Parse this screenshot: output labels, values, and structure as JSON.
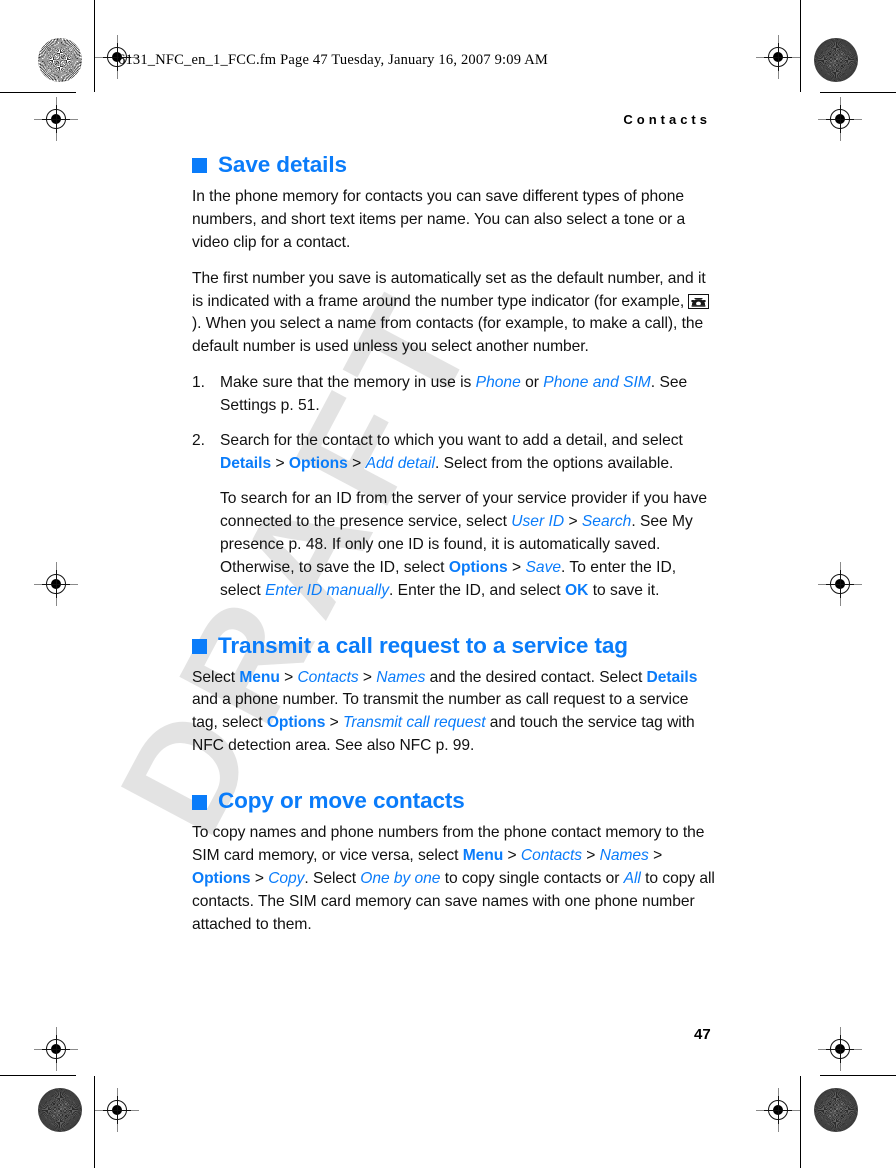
{
  "document": {
    "file_line": "6131_NFC_en_1_FCC.fm  Page 47  Tuesday, January 16, 2007  9:09 AM",
    "running_head": "Contacts",
    "folio": "47",
    "watermark": "DRAFT",
    "accent_color": "#0a7cfa",
    "text_color": "#111111",
    "watermark_color": "#e3e3e3"
  },
  "sections": [
    {
      "heading": "Save details",
      "bullet_icon": "blue-square-bullet",
      "paragraphs": [
        "In the phone memory for contacts you can save different types of phone numbers, and short text items per name. You can also select a tone or a video clip for a contact."
      ],
      "para2": {
        "part1": "The first number you save is automatically set as the default number, and it is indicated with a frame around the number type indicator (for example, ",
        "icon": "telephone-icon",
        "part2": "). When you select a name from contacts (for example, to make a call), the default number is used unless you select another number."
      },
      "steps": [
        {
          "num": "1.",
          "t1": "Make sure that the memory in use is ",
          "v1": "Phone",
          "t2": " or ",
          "v2": "Phone and SIM",
          "t3": ". See Settings p. 51."
        },
        {
          "num": "2.",
          "t1": "Search for the contact to which you want to add a detail, and select ",
          "c1": "Details",
          "sep1": " > ",
          "c2": "Options",
          "sep2": " > ",
          "v1": "Add detail",
          "t2": ". Select from the options available.",
          "sub": {
            "s1": "To search for an ID from the server of your service provider if you have connected to the presence service, select ",
            "v1": "User ID",
            "sep1": " > ",
            "v2": "Search",
            "s2": ". See My presence p. 48. If only one ID is found, it is automatically saved. Otherwise, to save the ID, select ",
            "c1": "Options",
            "sep2": " > ",
            "v3": "Save",
            "s3": ". To enter the ID, select ",
            "v4": "Enter ID manually",
            "s4": ". Enter the ID, and select ",
            "c2": "OK",
            "s5": " to save it."
          }
        }
      ]
    },
    {
      "heading": "Transmit a call request to a service tag",
      "bullet_icon": "blue-square-bullet",
      "rich": {
        "s1": "Select ",
        "c1": "Menu",
        "sep1": " > ",
        "v1": "Contacts",
        "sep2": " > ",
        "v2": "Names",
        "s2": " and the desired contact. Select ",
        "c2": "Details",
        "s3": " and a phone number. To transmit the number as call request to a service tag, select ",
        "c3": "Options",
        "sep3": " > ",
        "v3": "Transmit call request",
        "s4": " and touch the service tag with NFC detection area. See also NFC p. 99."
      }
    },
    {
      "heading": "Copy or move contacts",
      "bullet_icon": "blue-square-bullet",
      "rich": {
        "s1": "To copy names and phone numbers from the phone contact memory to the SIM card memory, or vice versa, select ",
        "c1": "Menu",
        "sep1": " > ",
        "v1": "Contacts",
        "sep2": " > ",
        "v2": "Names",
        "sep3": " > ",
        "c2": "Options",
        "sep4": " > ",
        "v3": "Copy",
        "s2": ". Select ",
        "v4": "One by one",
        "s3": " to copy single contacts or ",
        "v5": "All",
        "s4": " to copy all contacts. The SIM card memory can save names with one phone number attached to them."
      }
    }
  ]
}
